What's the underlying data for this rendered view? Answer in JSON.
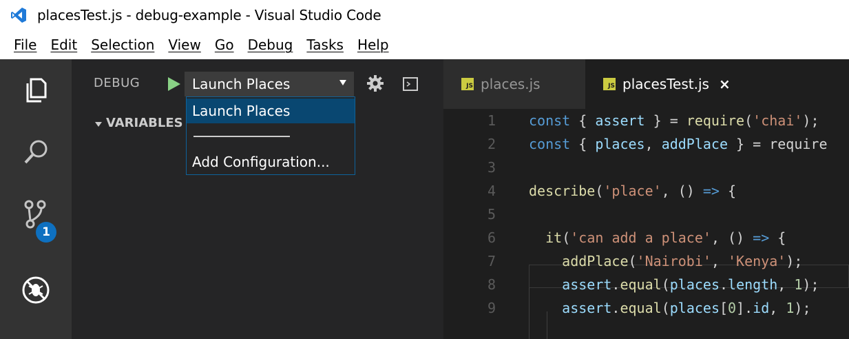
{
  "window": {
    "title": "placesTest.js - debug-example - Visual Studio Code"
  },
  "menu": [
    "File",
    "Edit",
    "Selection",
    "View",
    "Go",
    "Debug",
    "Tasks",
    "Help"
  ],
  "activity_bar": {
    "items": [
      "explorer-icon",
      "search-icon",
      "source-control-icon",
      "debug-icon"
    ],
    "source_control_badge": "1"
  },
  "debug": {
    "label": "DEBUG",
    "selected_config": "Launch Places",
    "dropdown_options": [
      "Launch Places",
      "Add Configuration..."
    ],
    "variables_label": "VARIABLES"
  },
  "tabs": [
    {
      "name": "places.js",
      "icon": "JS",
      "active": false
    },
    {
      "name": "placesTest.js",
      "icon": "JS",
      "active": true,
      "close": "×"
    }
  ],
  "code_lines": [
    {
      "n": "1",
      "text": "const { assert } = require('chai');"
    },
    {
      "n": "2",
      "text": "const { places, addPlace } = require"
    },
    {
      "n": "3",
      "text": ""
    },
    {
      "n": "4",
      "text": "describe('place', () => {"
    },
    {
      "n": "5",
      "text": ""
    },
    {
      "n": "6",
      "text": "  it('can add a place', () => {"
    },
    {
      "n": "7",
      "text": "    addPlace('Nairobi', 'Kenya');"
    },
    {
      "n": "8",
      "text": "    assert.equal(places.length, 1);"
    },
    {
      "n": "9",
      "text": "    assert.equal(places[0].id, 1);"
    }
  ],
  "colors": {
    "activity_bar": "#333333",
    "sidebar": "#252526",
    "editor": "#1e1e1e",
    "accent": "#0e70c0",
    "selection": "#094771"
  }
}
